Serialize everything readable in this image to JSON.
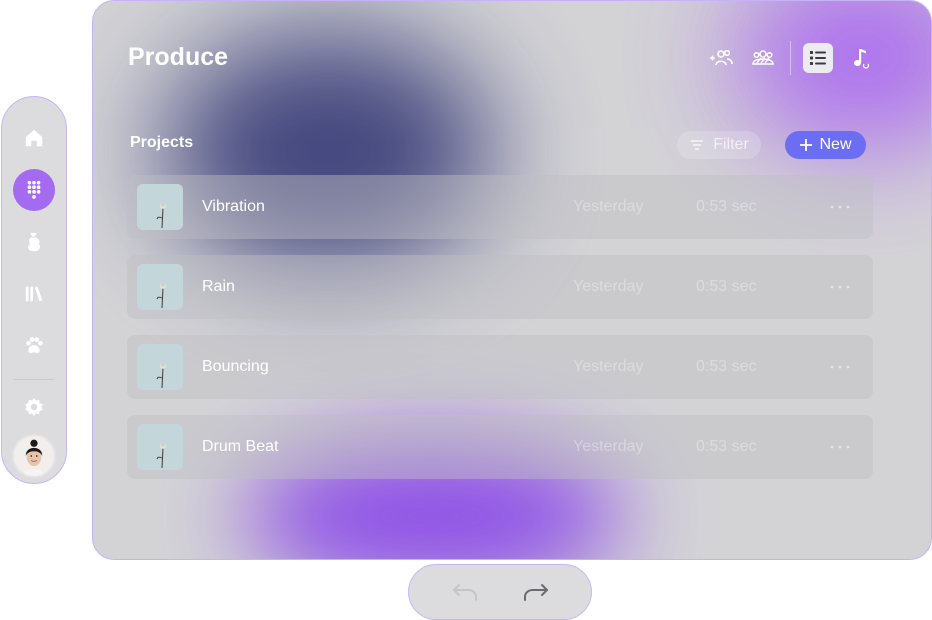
{
  "page": {
    "title": "Produce"
  },
  "rail": {
    "items": [
      {
        "name": "home-icon",
        "active": false
      },
      {
        "name": "dialpad-icon",
        "active": true
      },
      {
        "name": "music-bag-icon",
        "active": false
      },
      {
        "name": "library-icon",
        "active": false
      },
      {
        "name": "paw-icon",
        "active": false
      }
    ],
    "settings": {
      "name": "gear-icon"
    },
    "avatar": {
      "name": "avatar"
    }
  },
  "toolbar": {
    "icons": [
      {
        "name": "add-people-icon",
        "active": false
      },
      {
        "name": "group-icon",
        "active": false
      },
      {
        "name": "list-view-icon",
        "active": true
      },
      {
        "name": "music-note-icon",
        "active": false
      }
    ]
  },
  "projects": {
    "title": "Projects",
    "filter_label": "Filter",
    "new_label": "New",
    "rows": [
      {
        "title": "Vibration",
        "date": "Yesterday",
        "duration": "0:53 sec"
      },
      {
        "title": "Rain",
        "date": "Yesterday",
        "duration": "0:53 sec"
      },
      {
        "title": "Bouncing",
        "date": "Yesterday",
        "duration": "0:53 sec"
      },
      {
        "title": "Drum Beat",
        "date": "Yesterday",
        "duration": "0:53 sec"
      }
    ]
  },
  "bottom_nav": {
    "items": [
      {
        "name": "undo-icon",
        "enabled": false
      },
      {
        "name": "redo-icon",
        "enabled": true
      }
    ]
  },
  "colors": {
    "accent_purple": "#a46bf0",
    "new_button": "#6b6df3",
    "panel_bg": "#d3d3d6",
    "border": "#c6b3f5"
  }
}
